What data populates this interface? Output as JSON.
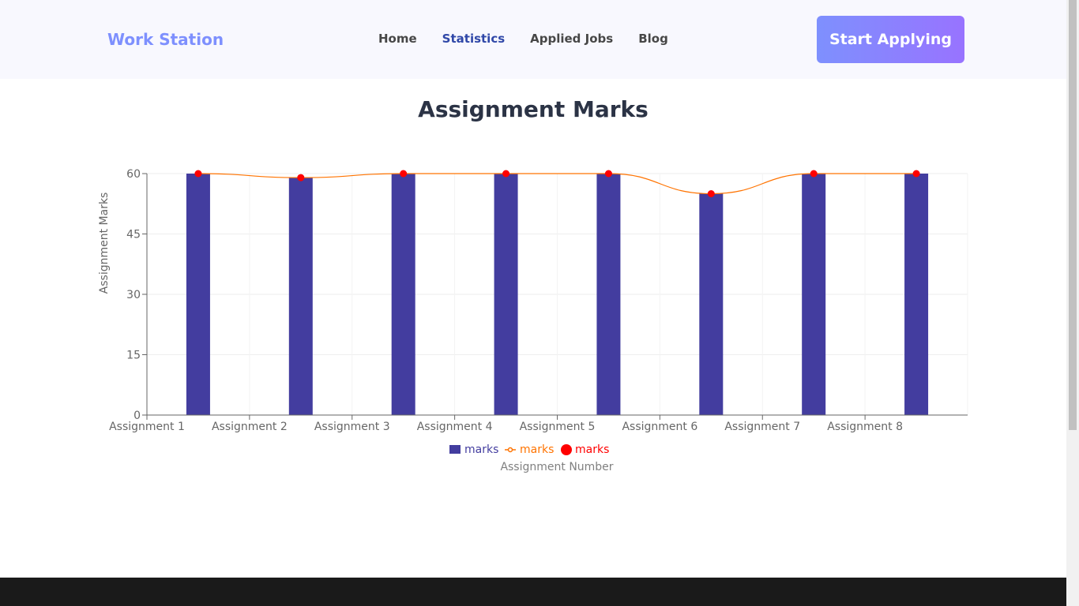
{
  "header": {
    "brand": "Work Station",
    "nav": [
      {
        "label": "Home",
        "active": false
      },
      {
        "label": "Statistics",
        "active": true
      },
      {
        "label": "Applied Jobs",
        "active": false
      },
      {
        "label": "Blog",
        "active": false
      }
    ],
    "cta_label": "Start Applying"
  },
  "page": {
    "title": "Assignment Marks"
  },
  "colors": {
    "bar": "#433d9f",
    "line": "#ff7300",
    "dot": "#ff0000",
    "brand": "#7e90fe",
    "active_nav": "#3048a8"
  },
  "chart_data": {
    "type": "bar",
    "title": "Assignment Marks",
    "xlabel": "Assignment Number",
    "ylabel": "Assignment Marks",
    "categories": [
      "Assignment 1",
      "Assignment 2",
      "Assignment 3",
      "Assignment 4",
      "Assignment 5",
      "Assignment 6",
      "Assignment 7",
      "Assignment 8"
    ],
    "series": [
      {
        "name": "marks",
        "kind": "bar",
        "values": [
          60,
          59,
          60,
          60,
          60,
          55,
          60,
          60
        ]
      },
      {
        "name": "marks",
        "kind": "line",
        "values": [
          60,
          59,
          60,
          60,
          60,
          55,
          60,
          60
        ]
      },
      {
        "name": "marks",
        "kind": "scatter",
        "values": [
          60,
          59,
          60,
          60,
          60,
          55,
          60,
          60
        ]
      }
    ],
    "yticks": [
      0,
      15,
      30,
      45,
      60
    ],
    "ylim": [
      0,
      60
    ],
    "grid": true,
    "legend": [
      "marks",
      "marks",
      "marks"
    ],
    "legend_position": "bottom"
  }
}
